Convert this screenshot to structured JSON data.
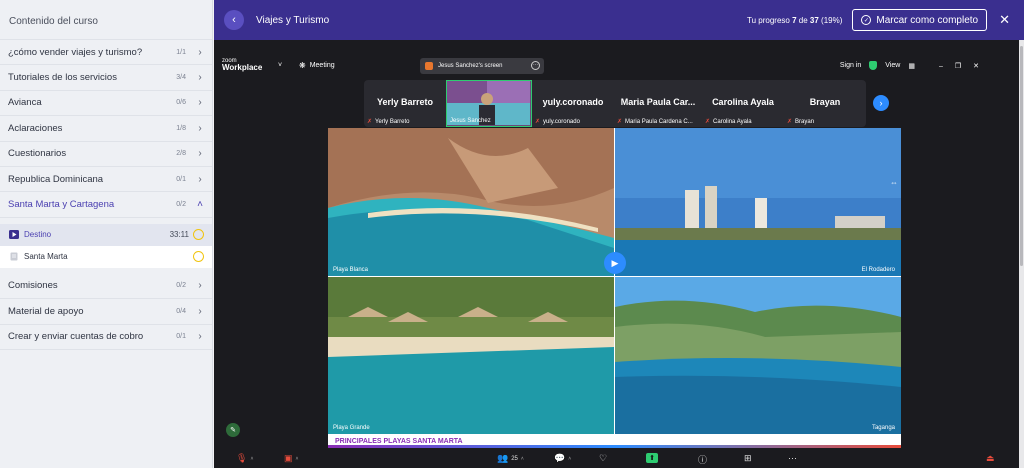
{
  "sidebar": {
    "title": "Contenido del curso",
    "items": [
      {
        "label": "¿cómo vender viajes y turismo?",
        "count": "1/1"
      },
      {
        "label": "Tutoriales de los servicios",
        "count": "3/4"
      },
      {
        "label": "Avianca",
        "count": "0/6"
      },
      {
        "label": "Aclaraciones",
        "count": "1/8"
      },
      {
        "label": "Cuestionarios",
        "count": "2/8"
      },
      {
        "label": "Republica Dominicana",
        "count": "0/1"
      },
      {
        "label": "Santa Marta y Cartagena",
        "count": "0/2"
      }
    ],
    "subitems": [
      {
        "label": "Destino",
        "duration": "33:11"
      },
      {
        "label": "Santa Marta",
        "duration": ""
      }
    ],
    "items_after": [
      {
        "label": "Comisiones",
        "count": "0/2"
      },
      {
        "label": "Material de apoyo",
        "count": "0/4"
      },
      {
        "label": "Crear y enviar cuentas de cobro",
        "count": "0/1"
      }
    ]
  },
  "header": {
    "title": "Viajes y Turismo",
    "progress_prefix": "Tu progreso",
    "progress_done": "7",
    "progress_of": "de",
    "progress_total": "37",
    "progress_pct": "(19%)",
    "progress_fraction": 0.19,
    "mark_label": "Marcar como completo",
    "accent": "#3a2f8f"
  },
  "zoom": {
    "logo_top": "zoom",
    "logo_bottom": "Workplace",
    "meeting_label": "Meeting",
    "share_label": "Jesus Sanchez's screen",
    "signin_label": "Sign in",
    "view_label": "View",
    "participants": [
      {
        "name": "Yerly Barreto",
        "small": "Yerly Barreto"
      },
      {
        "name": "",
        "small": "Jesus Sanchez",
        "speaker": true
      },
      {
        "name": "yuly.coronado",
        "small": "yuly.coronado"
      },
      {
        "name": "Maria Paula Car...",
        "small": "Maria Paula Cardena C..."
      },
      {
        "name": "Carolina Ayala",
        "small": "Carolina Ayala"
      },
      {
        "name": "Brayan",
        "small": "Brayan"
      }
    ],
    "participants_count": "25",
    "photos": [
      {
        "caption": "Playa Blanca"
      },
      {
        "caption": "El Rodadero"
      },
      {
        "caption": "Playa Grande"
      },
      {
        "caption": "Taganga"
      }
    ],
    "slide_footer": "PRINCIPALES PLAYAS SANTA MARTA"
  }
}
